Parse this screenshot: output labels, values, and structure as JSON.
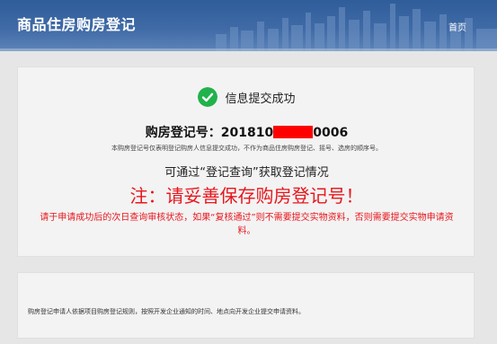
{
  "header": {
    "app_title": "商品住房购房登记",
    "nav_home": "首页"
  },
  "result": {
    "success_title": "信息提交成功",
    "registration_label": "购房登记号：",
    "registration_prefix": "201810",
    "registration_suffix": "0006",
    "note": "本购房登记号仅表明登记购房人信息提交成功，不作为商品住房购房登记、摇号、选房的顺序号。",
    "query_hint": "可通过“登记查询”获取登记情况",
    "warning": "注：请妥善保存购房登记号！",
    "warning_detail": "请于申请成功后的次日查询审核状态，如果“复核通过”则不需要提交实物资料，否则需要提交实物申请资料。"
  },
  "info": {
    "text": "购房登记申请人依据项目购房登记规则，按照开发企业通知的时间、地点向开发企业提交申请资料。"
  },
  "colors": {
    "header_blue": "#3f6aa6",
    "success_green": "#21b24b",
    "warning_red": "#e8161c",
    "redaction_red": "#ff0000"
  }
}
